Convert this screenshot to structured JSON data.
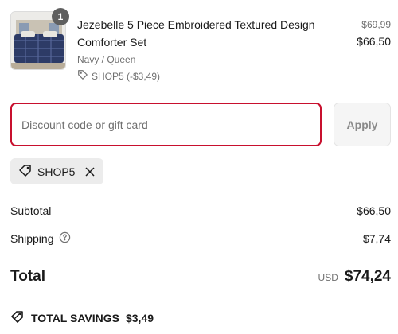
{
  "product": {
    "quantity": "1",
    "title": "Jezebelle 5 Piece Embroidered Textured Design Comforter Set",
    "variant": "Navy / Queen",
    "applied_code": "SHOP5 (-$3,49)",
    "original_price": "$69,99",
    "price": "$66,50"
  },
  "discount": {
    "placeholder": "Discount code or gift card",
    "value": "",
    "apply_label": "Apply",
    "applied_chip": "SHOP5"
  },
  "summary": {
    "subtotal_label": "Subtotal",
    "subtotal_value": "$66,50",
    "shipping_label": "Shipping",
    "shipping_value": "$7,74",
    "total_label": "Total",
    "currency": "USD",
    "total_value": "$74,24",
    "savings_label": "TOTAL SAVINGS",
    "savings_value": "$3,49"
  },
  "colors": {
    "accent_error": "#c8102e",
    "text_primary": "#1a1a1a",
    "text_muted": "#707070",
    "chip_bg": "#ececec"
  },
  "icons": [
    "tag-icon",
    "close-icon",
    "help-circle-icon",
    "savings-tag-icon"
  ]
}
